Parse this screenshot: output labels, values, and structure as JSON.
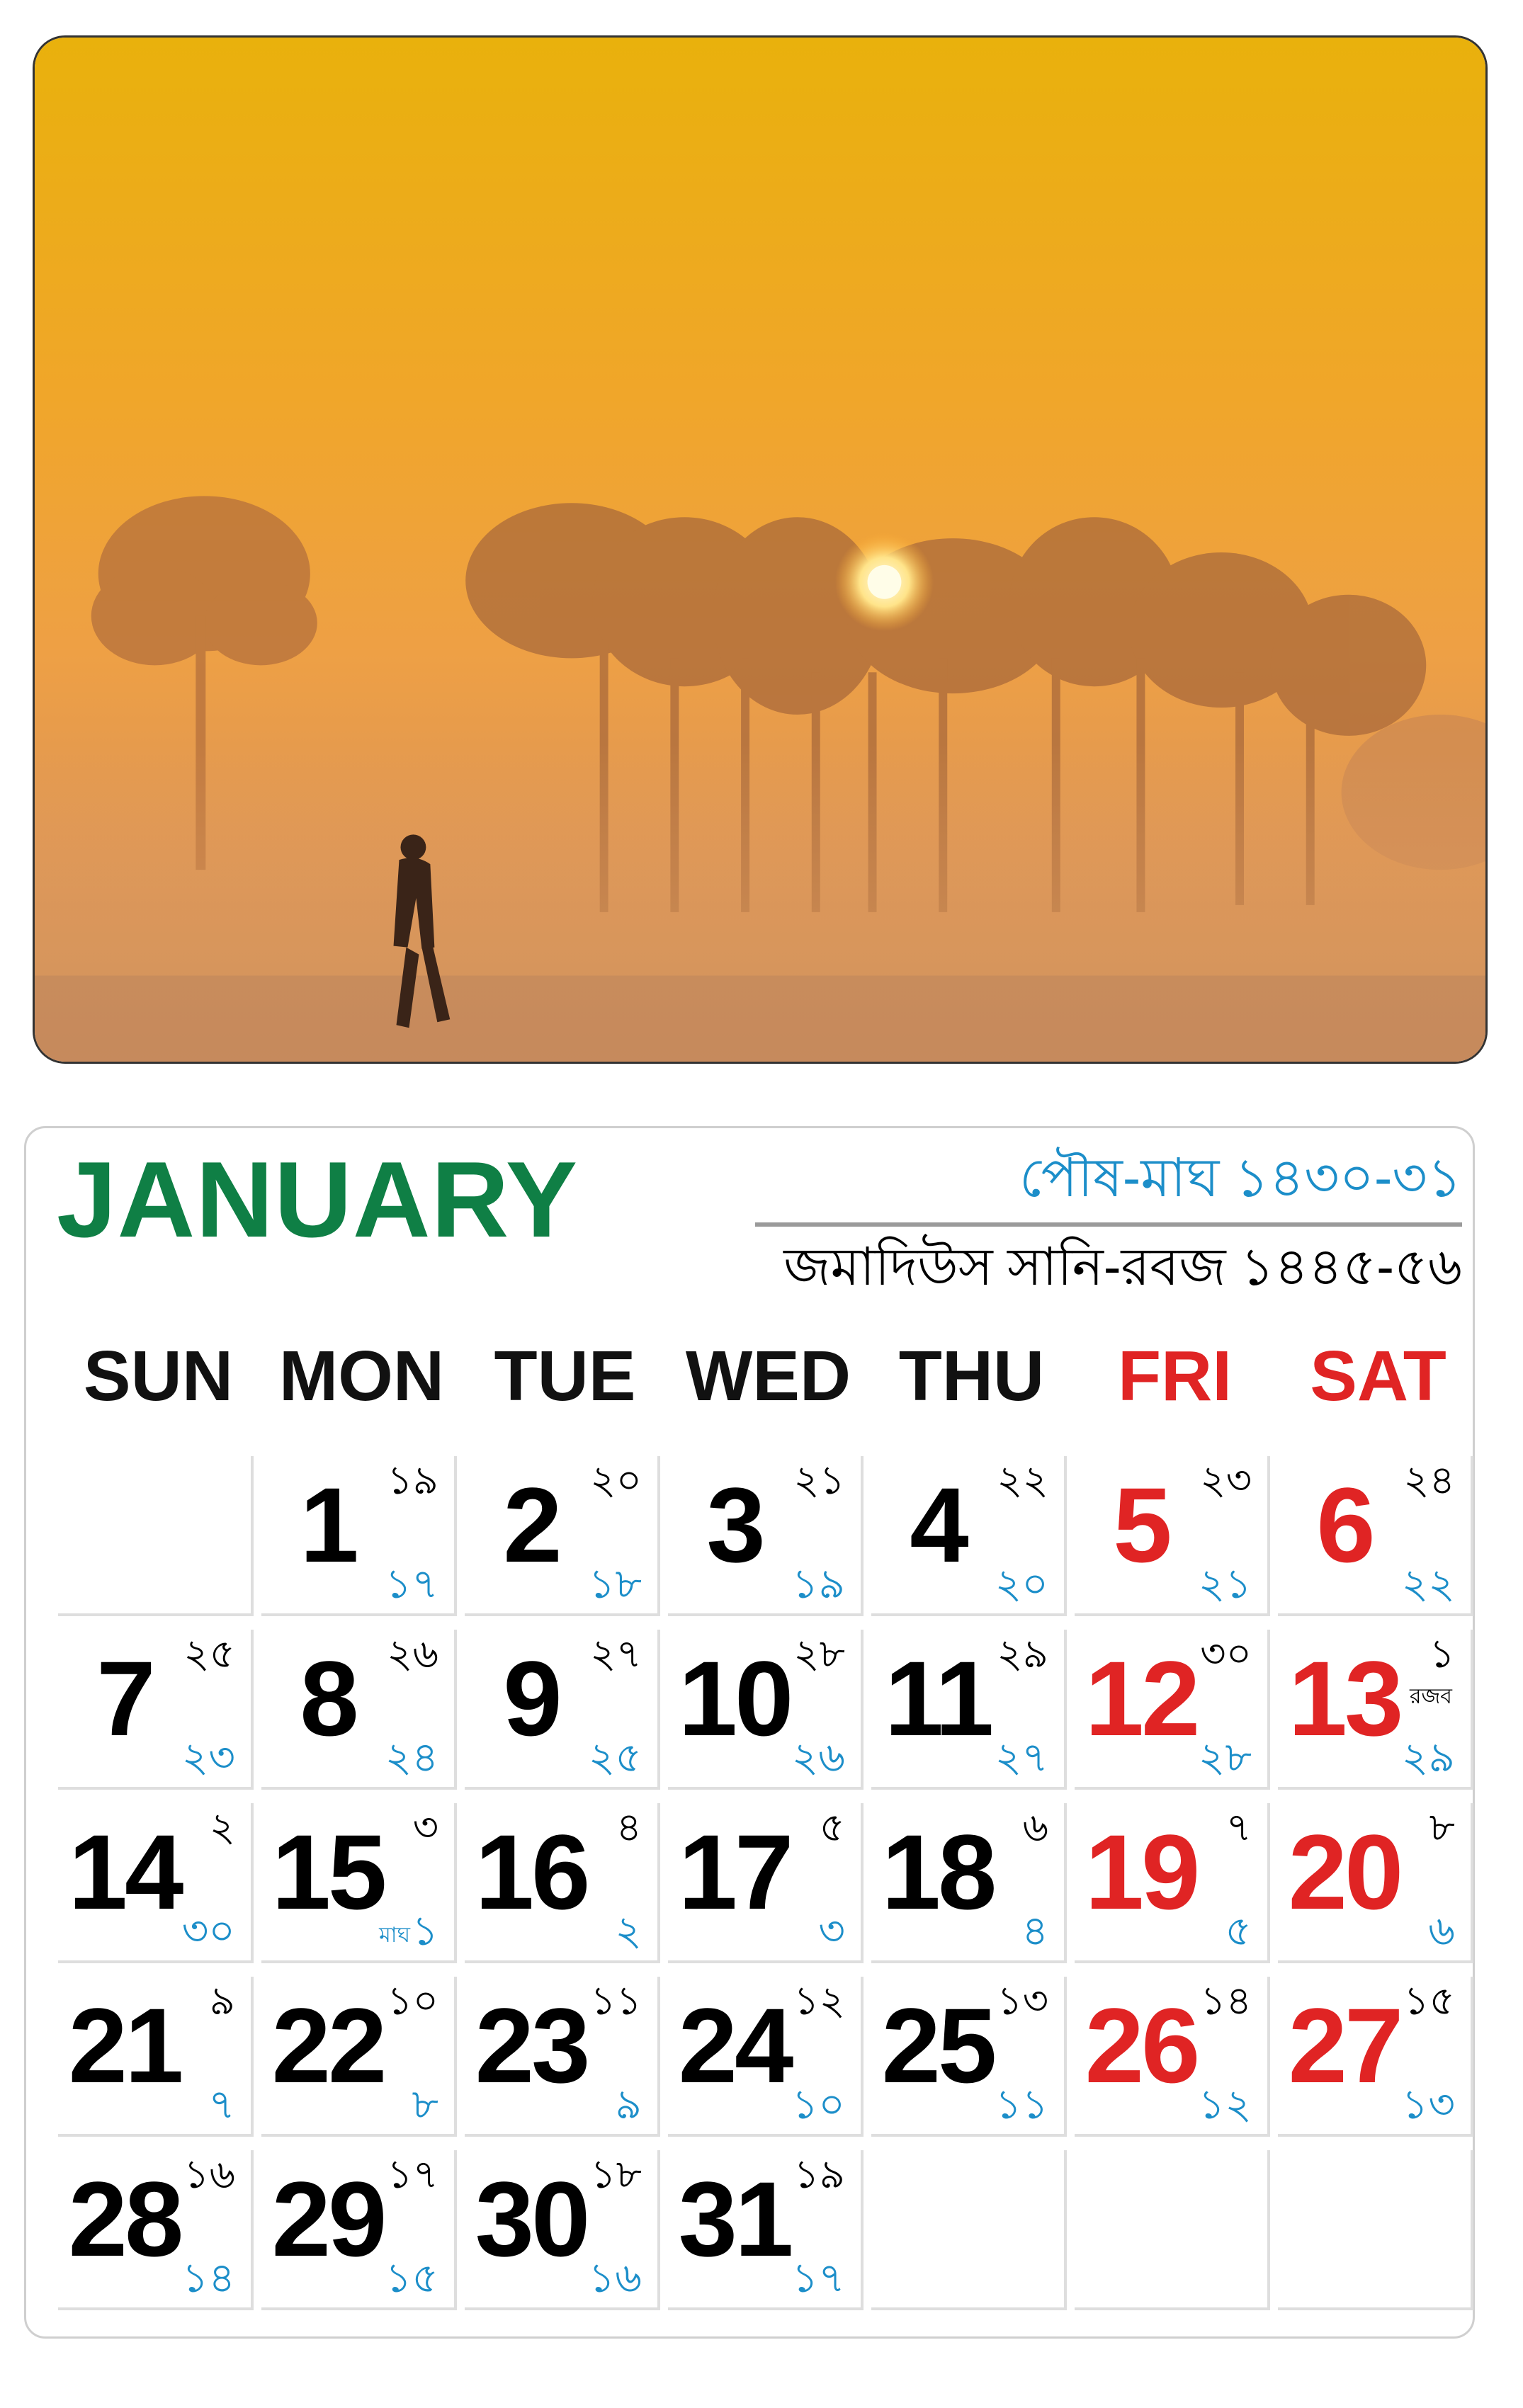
{
  "header": {
    "month": "JANUARY",
    "bangla_months": "পৌষ-মাঘ ১৪৩০-৩১",
    "hijri_months": "জমাদিউস সানি-রবজ ১৪৪৫-৫৬"
  },
  "weekdays": [
    {
      "label": "SUN",
      "holiday": false
    },
    {
      "label": "MON",
      "holiday": false
    },
    {
      "label": "TUE",
      "holiday": false
    },
    {
      "label": "WED",
      "holiday": false
    },
    {
      "label": "THU",
      "holiday": false
    },
    {
      "label": "FRI",
      "holiday": true
    },
    {
      "label": "SAT",
      "holiday": true
    }
  ],
  "days": [
    null,
    {
      "day": "1",
      "bangla": "১৯",
      "hijri": "১৭"
    },
    {
      "day": "2",
      "bangla": "২০",
      "hijri": "১৮"
    },
    {
      "day": "3",
      "bangla": "২১",
      "hijri": "১৯"
    },
    {
      "day": "4",
      "bangla": "২২",
      "hijri": "২০"
    },
    {
      "day": "5",
      "bangla": "২৩",
      "hijri": "২১",
      "holiday": true
    },
    {
      "day": "6",
      "bangla": "২৪",
      "hijri": "২২",
      "holiday": true
    },
    {
      "day": "7",
      "bangla": "২৫",
      "hijri": "২৩"
    },
    {
      "day": "8",
      "bangla": "২৬",
      "hijri": "২৪"
    },
    {
      "day": "9",
      "bangla": "২৭",
      "hijri": "২৫"
    },
    {
      "day": "10",
      "bangla": "২৮",
      "hijri": "২৬"
    },
    {
      "day": "11",
      "bangla": "২৯",
      "hijri": "২৭"
    },
    {
      "day": "12",
      "bangla": "৩০",
      "hijri": "২৮",
      "holiday": true
    },
    {
      "day": "13",
      "bangla": "১",
      "hijri": "২৯",
      "holiday": true,
      "note_top": "রজব"
    },
    {
      "day": "14",
      "bangla": "২",
      "hijri": "৩০"
    },
    {
      "day": "15",
      "bangla": "৩",
      "hijri": "১",
      "note_bottom": "মাঘ"
    },
    {
      "day": "16",
      "bangla": "৪",
      "hijri": "২"
    },
    {
      "day": "17",
      "bangla": "৫",
      "hijri": "৩"
    },
    {
      "day": "18",
      "bangla": "৬",
      "hijri": "৪"
    },
    {
      "day": "19",
      "bangla": "৭",
      "hijri": "৫",
      "holiday": true
    },
    {
      "day": "20",
      "bangla": "৮",
      "hijri": "৬",
      "holiday": true
    },
    {
      "day": "21",
      "bangla": "৯",
      "hijri": "৭"
    },
    {
      "day": "22",
      "bangla": "১০",
      "hijri": "৮"
    },
    {
      "day": "23",
      "bangla": "১১",
      "hijri": "৯"
    },
    {
      "day": "24",
      "bangla": "১২",
      "hijri": "১০"
    },
    {
      "day": "25",
      "bangla": "১৩",
      "hijri": "১১"
    },
    {
      "day": "26",
      "bangla": "১৪",
      "hijri": "১২",
      "holiday": true
    },
    {
      "day": "27",
      "bangla": "১৫",
      "hijri": "১৩",
      "holiday": true
    },
    {
      "day": "28",
      "bangla": "১৬",
      "hijri": "১৪"
    },
    {
      "day": "29",
      "bangla": "১৭",
      "hijri": "১৫"
    },
    {
      "day": "30",
      "bangla": "১৮",
      "hijri": "১৬"
    },
    {
      "day": "31",
      "bangla": "১৯",
      "hijri": "১৭"
    },
    null,
    null,
    null
  ],
  "colors": {
    "month": "#0f7f45",
    "holiday": "#e02424",
    "bangla_accent": "#1c8ec9"
  }
}
